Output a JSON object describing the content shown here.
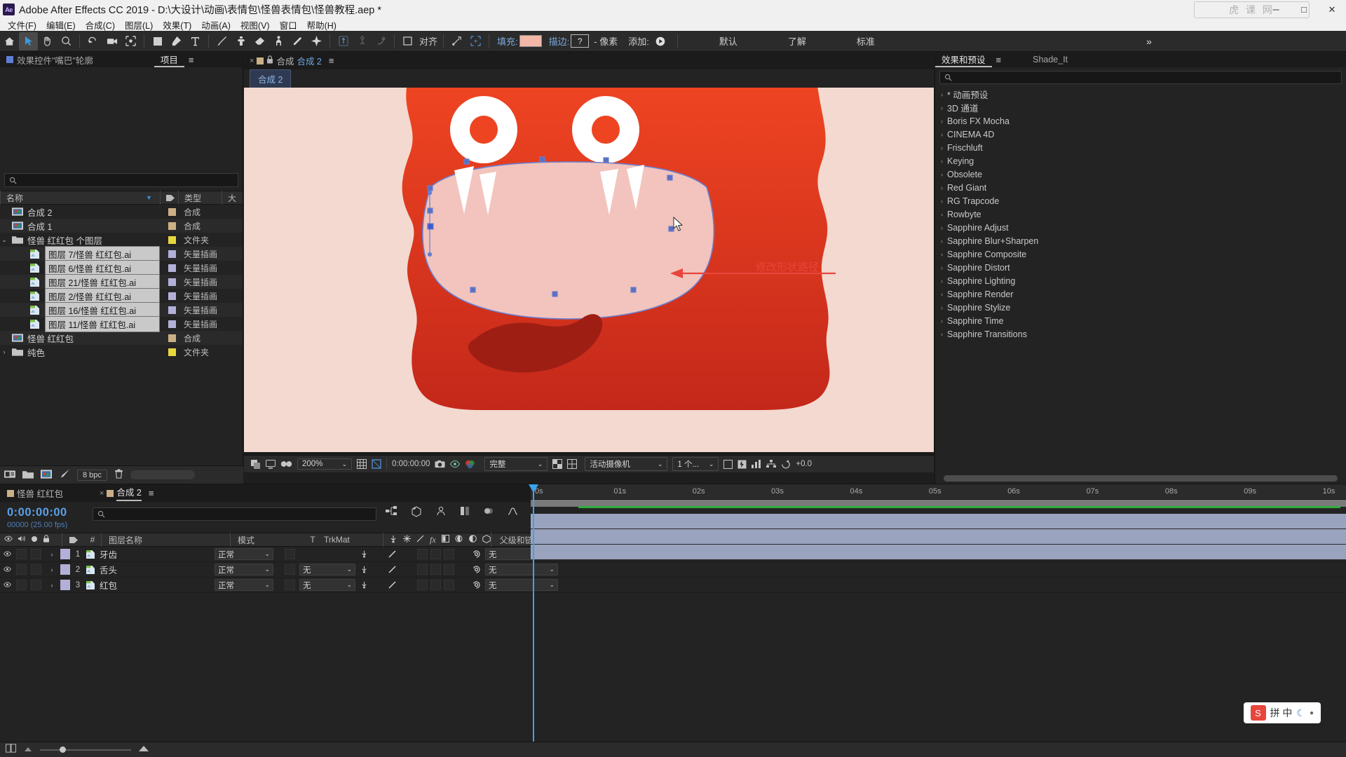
{
  "titlebar": {
    "app_badge": "Ae",
    "title": "Adobe After Effects CC 2019 - D:\\大设计\\动画\\表情包\\怪兽表情包\\怪兽教程.aep *",
    "minimize": "─",
    "maximize": "□",
    "close": "✕",
    "watermark": "虎 课 网"
  },
  "menubar": {
    "items": [
      "文件(F)",
      "编辑(E)",
      "合成(C)",
      "图层(L)",
      "效果(T)",
      "动画(A)",
      "视图(V)",
      "窗口",
      "帮助(H)"
    ]
  },
  "toolbar": {
    "align_label": "对齐",
    "fill_label": "填充:",
    "fill_color": "#f3b7a7",
    "stroke_label": "描边:",
    "stroke_value": "?",
    "stroke_units": "- 像素",
    "add_label": "添加:",
    "workspaces": [
      "默认",
      "了解",
      "标准"
    ],
    "overflow": "»"
  },
  "left_panel": {
    "tabs": [
      {
        "label": "效果控件\"嘴巴\"轮廓",
        "active": false,
        "icon": "blue-square-icon"
      },
      {
        "label": "项目",
        "active": true,
        "icon": "none"
      }
    ],
    "menu_icon": "≡",
    "search_placeholder": "",
    "columns": [
      "名称",
      "类型",
      "大"
    ],
    "sort_icon": "▼",
    "tag_icon": "tag-icon",
    "rows": [
      {
        "name": "合成 2",
        "type": "合成",
        "icon": "comp-icon",
        "swatch": "#cbb086",
        "depth": 0,
        "selected": false,
        "twisty": ""
      },
      {
        "name": "合成 1",
        "type": "合成",
        "icon": "comp-icon",
        "swatch": "#cbb086",
        "depth": 0,
        "selected": false,
        "twisty": ""
      },
      {
        "name": "怪兽 红红包 个图层",
        "type": "文件夹",
        "icon": "folder-icon",
        "swatch": "#e8d63f",
        "depth": 0,
        "selected": false,
        "twisty": "⌄"
      },
      {
        "name": "图层 7/怪兽 红红包.ai",
        "type": "矢量插画",
        "icon": "ai-icon",
        "swatch": "#b3b0d8",
        "depth": 1,
        "selected": true,
        "twisty": ""
      },
      {
        "name": "图层 6/怪兽 红红包.ai",
        "type": "矢量插画",
        "icon": "ai-icon",
        "swatch": "#b3b0d8",
        "depth": 1,
        "selected": true,
        "twisty": ""
      },
      {
        "name": "图层 21/怪兽 红红包.ai",
        "type": "矢量插画",
        "icon": "ai-icon",
        "swatch": "#b3b0d8",
        "depth": 1,
        "selected": true,
        "twisty": ""
      },
      {
        "name": "图层 2/怪兽 红红包.ai",
        "type": "矢量插画",
        "icon": "ai-icon",
        "swatch": "#b3b0d8",
        "depth": 1,
        "selected": true,
        "twisty": ""
      },
      {
        "name": "图层 16/怪兽 红红包.ai",
        "type": "矢量插画",
        "icon": "ai-icon",
        "swatch": "#b3b0d8",
        "depth": 1,
        "selected": true,
        "twisty": ""
      },
      {
        "name": "图层 11/怪兽 红红包.ai",
        "type": "矢量插画",
        "icon": "ai-icon",
        "swatch": "#b3b0d8",
        "depth": 1,
        "selected": true,
        "twisty": ""
      },
      {
        "name": "怪兽 红红包",
        "type": "合成",
        "icon": "comp-icon",
        "swatch": "#cbb086",
        "depth": 0,
        "selected": false,
        "twisty": ""
      },
      {
        "name": "纯色",
        "type": "文件夹",
        "icon": "folder-icon",
        "swatch": "#e8d63f",
        "depth": 0,
        "selected": false,
        "twisty": "›"
      }
    ],
    "footer": {
      "bpc": "8 bpc",
      "icons": [
        "interpret-footage-icon",
        "new-folder-icon",
        "new-comp-icon",
        "project-settings-icon",
        "delete-icon"
      ]
    }
  },
  "comp_viewer": {
    "tab_close": "×",
    "lock_icon": "lock-icon",
    "tab_prefix": "合成",
    "tab_name": "合成 2",
    "menu_icon": "≡",
    "breadcrumb": "合成 2",
    "annotation": "修改形状路径",
    "bottom_bar": {
      "zoom": "200%",
      "time": "0:00:00:00",
      "quality": "完整",
      "camera": "活动摄像机",
      "views": "1 个...",
      "exposure": "+0.0"
    }
  },
  "right_panel": {
    "tabs": [
      {
        "label": "效果和预设",
        "active": true
      },
      {
        "label": "Shade_It",
        "active": false
      }
    ],
    "menu_icon": "≡",
    "search_placeholder": "",
    "items": [
      "* 动画预设",
      "3D 通道",
      "Boris FX Mocha",
      "CINEMA 4D",
      "Frischluft",
      "Keying",
      "Obsolete",
      "Red Giant",
      "RG Trapcode",
      "Rowbyte",
      "Sapphire Adjust",
      "Sapphire Blur+Sharpen",
      "Sapphire Composite",
      "Sapphire Distort",
      "Sapphire Lighting",
      "Sapphire Render",
      "Sapphire Stylize",
      "Sapphire Time",
      "Sapphire Transitions"
    ]
  },
  "timeline": {
    "tabs": [
      {
        "label": "怪兽 红红包",
        "active": false
      },
      {
        "label": "合成 2",
        "active": true
      }
    ],
    "close_icon": "×",
    "menu_icon": "≡",
    "current_time": "0:00:00:00",
    "frames": "00000 (25.00 fps)",
    "search_placeholder": "",
    "columns": {
      "num": "#",
      "name": "图层名称",
      "mode": "模式",
      "t": "T",
      "trkmat": "TrkMat",
      "parent": "父级和链接"
    },
    "rows": [
      {
        "num": "1",
        "name": "牙齿",
        "mode": "正常",
        "trkmat": "",
        "parent": "无",
        "color": "#b3b0d8"
      },
      {
        "num": "2",
        "name": "舌头",
        "mode": "正常",
        "trkmat": "无",
        "parent": "无",
        "color": "#b3b0d8"
      },
      {
        "num": "3",
        "name": "红包",
        "mode": "正常",
        "trkmat": "无",
        "parent": "无",
        "color": "#b3b0d8"
      }
    ],
    "ruler_ticks": [
      "0s",
      "01s",
      "02s",
      "03s",
      "04s",
      "05s",
      "06s",
      "07s",
      "08s",
      "09s",
      "10s"
    ]
  },
  "floating_badge": {
    "icon": "S",
    "text": "拼 中",
    "moon": "☾",
    "dot": "●"
  },
  "artwork": {
    "bg_color": "#f3d9cf",
    "body_color": "#e8401f",
    "body_color_dark": "#c62d18",
    "mouth_color": "#f2c4bd",
    "tooth_color": "#ffffff",
    "nostril_color": "#9e1e14",
    "path_stroke": "#6a7fd0"
  }
}
